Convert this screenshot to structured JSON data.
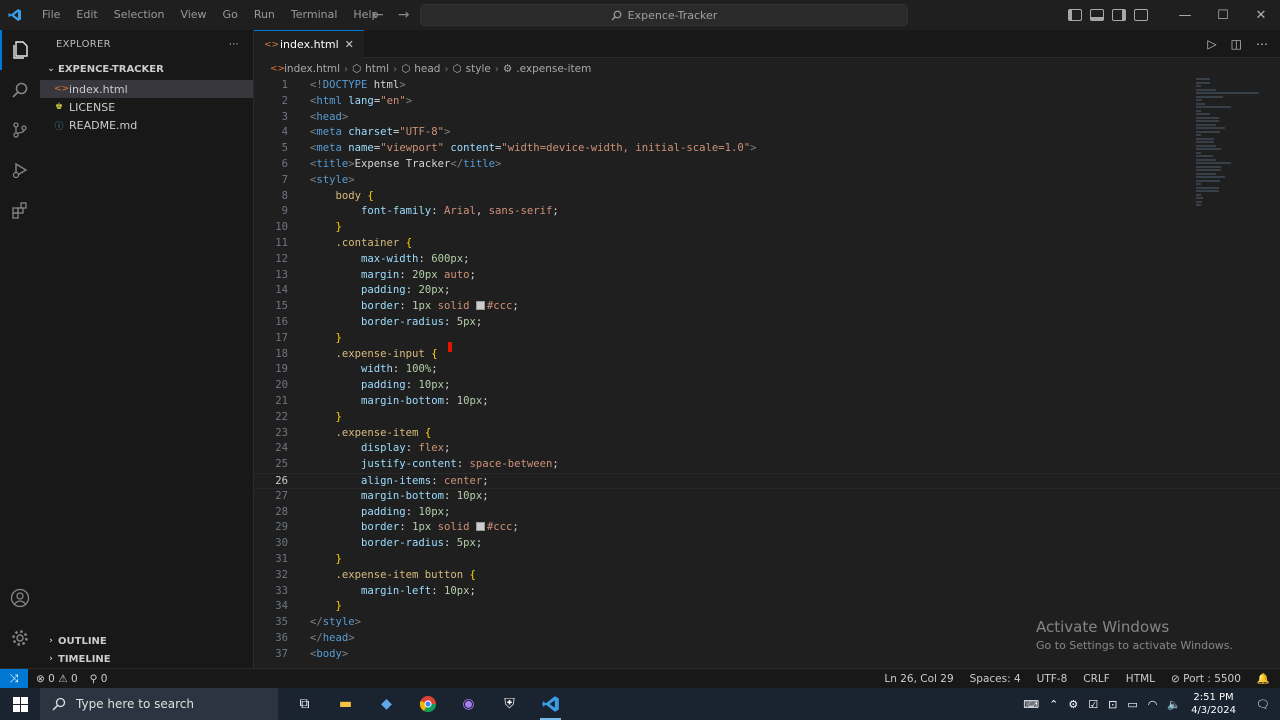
{
  "titlebar": {
    "menu": [
      "File",
      "Edit",
      "Selection",
      "View",
      "Go",
      "Run",
      "Terminal",
      "Help"
    ],
    "command_center": "Expence-Tracker",
    "window_controls": [
      "minimize-icon",
      "restore-icon",
      "close-icon"
    ]
  },
  "activity_bar": {
    "items": [
      "explorer-icon",
      "search-icon",
      "source-control-icon",
      "run-debug-icon",
      "extensions-icon"
    ],
    "bottom": [
      "account-icon",
      "settings-gear-icon"
    ]
  },
  "sidebar": {
    "title": "EXPLORER",
    "folder": "EXPENCE-TRACKER",
    "files": [
      {
        "name": "index.html",
        "icon": "html-file-icon"
      },
      {
        "name": "LICENSE",
        "icon": "license-file-icon"
      },
      {
        "name": "README.md",
        "icon": "markdown-file-icon"
      }
    ],
    "outline": "OUTLINE",
    "timeline": "TIMELINE"
  },
  "editor": {
    "tab": "index.html",
    "breadcrumb": [
      "index.html",
      "html",
      "head",
      "style",
      ".expense-item"
    ],
    "current_line": 26,
    "lines": [
      [
        [
          "brk",
          "<!"
        ],
        [
          "tag",
          "DOCTYPE"
        ],
        [
          "txt",
          " html"
        ],
        [
          "brk",
          ">"
        ]
      ],
      [
        [
          "brk",
          "<"
        ],
        [
          "tag",
          "html"
        ],
        [
          "txt",
          " "
        ],
        [
          "attr",
          "lang"
        ],
        [
          "pun",
          "="
        ],
        [
          "str",
          "\"en\""
        ],
        [
          "brk",
          ">"
        ]
      ],
      [
        [
          "brk",
          "<"
        ],
        [
          "tag",
          "head"
        ],
        [
          "brk",
          ">"
        ]
      ],
      [
        [
          "brk",
          "<"
        ],
        [
          "tag",
          "meta"
        ],
        [
          "txt",
          " "
        ],
        [
          "attr",
          "charset"
        ],
        [
          "pun",
          "="
        ],
        [
          "str",
          "\"UTF-8\""
        ],
        [
          "brk",
          ">"
        ]
      ],
      [
        [
          "brk",
          "<"
        ],
        [
          "tag",
          "meta"
        ],
        [
          "txt",
          " "
        ],
        [
          "attr",
          "name"
        ],
        [
          "pun",
          "="
        ],
        [
          "str",
          "\"viewport\""
        ],
        [
          "txt",
          " "
        ],
        [
          "attr",
          "content"
        ],
        [
          "pun",
          "="
        ],
        [
          "str",
          "\"width=device-width, initial-scale=1.0\""
        ],
        [
          "brk",
          ">"
        ]
      ],
      [
        [
          "brk",
          "<"
        ],
        [
          "tag",
          "title"
        ],
        [
          "brk",
          ">"
        ],
        [
          "txt",
          "Expense Tracker"
        ],
        [
          "brk",
          "</"
        ],
        [
          "tag",
          "title"
        ],
        [
          "brk",
          ">"
        ]
      ],
      [
        [
          "brk",
          "<"
        ],
        [
          "tag",
          "style"
        ],
        [
          "brk",
          ">"
        ]
      ],
      [
        [
          "txt",
          "    "
        ],
        [
          "sel",
          "body"
        ],
        [
          "txt",
          " "
        ],
        [
          "br",
          "{"
        ]
      ],
      [
        [
          "txt",
          "        "
        ],
        [
          "prop",
          "font-family"
        ],
        [
          "pun",
          ": "
        ],
        [
          "val",
          "Arial"
        ],
        [
          "pun",
          ", "
        ],
        [
          "val",
          "sans-serif"
        ],
        [
          "pun",
          ";"
        ]
      ],
      [
        [
          "txt",
          "    "
        ],
        [
          "br",
          "}"
        ]
      ],
      [
        [
          "txt",
          "    "
        ],
        [
          "sel",
          ".container"
        ],
        [
          "txt",
          " "
        ],
        [
          "br",
          "{"
        ]
      ],
      [
        [
          "txt",
          "        "
        ],
        [
          "prop",
          "max-width"
        ],
        [
          "pun",
          ": "
        ],
        [
          "num",
          "600px"
        ],
        [
          "pun",
          ";"
        ]
      ],
      [
        [
          "txt",
          "        "
        ],
        [
          "prop",
          "margin"
        ],
        [
          "pun",
          ": "
        ],
        [
          "num",
          "20px"
        ],
        [
          "txt",
          " "
        ],
        [
          "val",
          "auto"
        ],
        [
          "pun",
          ";"
        ]
      ],
      [
        [
          "txt",
          "        "
        ],
        [
          "prop",
          "padding"
        ],
        [
          "pun",
          ": "
        ],
        [
          "num",
          "20px"
        ],
        [
          "pun",
          ";"
        ]
      ],
      [
        [
          "txt",
          "        "
        ],
        [
          "prop",
          "border"
        ],
        [
          "pun",
          ": "
        ],
        [
          "num",
          "1px"
        ],
        [
          "txt",
          " "
        ],
        [
          "val",
          "solid"
        ],
        [
          "txt",
          " "
        ],
        [
          "swatch",
          ""
        ],
        [
          "val",
          "#ccc"
        ],
        [
          "pun",
          ";"
        ]
      ],
      [
        [
          "txt",
          "        "
        ],
        [
          "prop",
          "border-radius"
        ],
        [
          "pun",
          ": "
        ],
        [
          "num",
          "5px"
        ],
        [
          "pun",
          ";"
        ]
      ],
      [
        [
          "txt",
          "    "
        ],
        [
          "br",
          "}"
        ]
      ],
      [
        [
          "txt",
          "    "
        ],
        [
          "sel",
          ".expense-input"
        ],
        [
          "txt",
          " "
        ],
        [
          "br",
          "{"
        ]
      ],
      [
        [
          "txt",
          "        "
        ],
        [
          "prop",
          "width"
        ],
        [
          "pun",
          ": "
        ],
        [
          "num",
          "100%"
        ],
        [
          "pun",
          ";"
        ]
      ],
      [
        [
          "txt",
          "        "
        ],
        [
          "prop",
          "padding"
        ],
        [
          "pun",
          ": "
        ],
        [
          "num",
          "10px"
        ],
        [
          "pun",
          ";"
        ]
      ],
      [
        [
          "txt",
          "        "
        ],
        [
          "prop",
          "margin-bottom"
        ],
        [
          "pun",
          ": "
        ],
        [
          "num",
          "10px"
        ],
        [
          "pun",
          ";"
        ]
      ],
      [
        [
          "txt",
          "    "
        ],
        [
          "br",
          "}"
        ]
      ],
      [
        [
          "txt",
          "    "
        ],
        [
          "sel",
          ".expense-item"
        ],
        [
          "txt",
          " "
        ],
        [
          "br",
          "{"
        ]
      ],
      [
        [
          "txt",
          "        "
        ],
        [
          "prop",
          "display"
        ],
        [
          "pun",
          ": "
        ],
        [
          "val",
          "flex"
        ],
        [
          "pun",
          ";"
        ]
      ],
      [
        [
          "txt",
          "        "
        ],
        [
          "prop",
          "justify-content"
        ],
        [
          "pun",
          ": "
        ],
        [
          "val",
          "space-between"
        ],
        [
          "pun",
          ";"
        ]
      ],
      [
        [
          "txt",
          "        "
        ],
        [
          "prop",
          "align-items"
        ],
        [
          "pun",
          ": "
        ],
        [
          "val",
          "center"
        ],
        [
          "pun",
          ";"
        ]
      ],
      [
        [
          "txt",
          "        "
        ],
        [
          "prop",
          "margin-bottom"
        ],
        [
          "pun",
          ": "
        ],
        [
          "num",
          "10px"
        ],
        [
          "pun",
          ";"
        ]
      ],
      [
        [
          "txt",
          "        "
        ],
        [
          "prop",
          "padding"
        ],
        [
          "pun",
          ": "
        ],
        [
          "num",
          "10px"
        ],
        [
          "pun",
          ";"
        ]
      ],
      [
        [
          "txt",
          "        "
        ],
        [
          "prop",
          "border"
        ],
        [
          "pun",
          ": "
        ],
        [
          "num",
          "1px"
        ],
        [
          "txt",
          " "
        ],
        [
          "val",
          "solid"
        ],
        [
          "txt",
          " "
        ],
        [
          "swatch",
          ""
        ],
        [
          "val",
          "#ccc"
        ],
        [
          "pun",
          ";"
        ]
      ],
      [
        [
          "txt",
          "        "
        ],
        [
          "prop",
          "border-radius"
        ],
        [
          "pun",
          ": "
        ],
        [
          "num",
          "5px"
        ],
        [
          "pun",
          ";"
        ]
      ],
      [
        [
          "txt",
          "    "
        ],
        [
          "br",
          "}"
        ]
      ],
      [
        [
          "txt",
          "    "
        ],
        [
          "sel",
          ".expense-item button"
        ],
        [
          "txt",
          " "
        ],
        [
          "br",
          "{"
        ]
      ],
      [
        [
          "txt",
          "        "
        ],
        [
          "prop",
          "margin-left"
        ],
        [
          "pun",
          ": "
        ],
        [
          "num",
          "10px"
        ],
        [
          "pun",
          ";"
        ]
      ],
      [
        [
          "txt",
          "    "
        ],
        [
          "br",
          "}"
        ]
      ],
      [
        [
          "brk",
          "</"
        ],
        [
          "tag",
          "style"
        ],
        [
          "brk",
          ">"
        ]
      ],
      [
        [
          "brk",
          "</"
        ],
        [
          "tag",
          "head"
        ],
        [
          "brk",
          ">"
        ]
      ],
      [
        [
          "brk",
          "<"
        ],
        [
          "tag",
          "body"
        ],
        [
          "brk",
          ">"
        ]
      ]
    ]
  },
  "watermark": {
    "title": "Activate Windows",
    "subtitle": "Go to Settings to activate Windows."
  },
  "statusbar": {
    "errors": "0",
    "warnings": "0",
    "ports": "0",
    "position": "Ln 26, Col 29",
    "spaces": "Spaces: 4",
    "encoding": "UTF-8",
    "eol": "CRLF",
    "language": "HTML",
    "port": "Port : 5500"
  },
  "taskbar": {
    "search_placeholder": "Type here to search",
    "apps": [
      "task-view-icon",
      "file-explorer-icon",
      "store-icon",
      "chrome-icon",
      "github-desktop-icon",
      "security-icon",
      "vscode-icon"
    ],
    "time": "2:51 PM",
    "date": "4/3/2024"
  },
  "colors": {
    "accent": "#0078d4",
    "editor_bg": "#1f1f1f",
    "sidebar_bg": "#181818",
    "taskbar_bg": "#1a2330"
  }
}
